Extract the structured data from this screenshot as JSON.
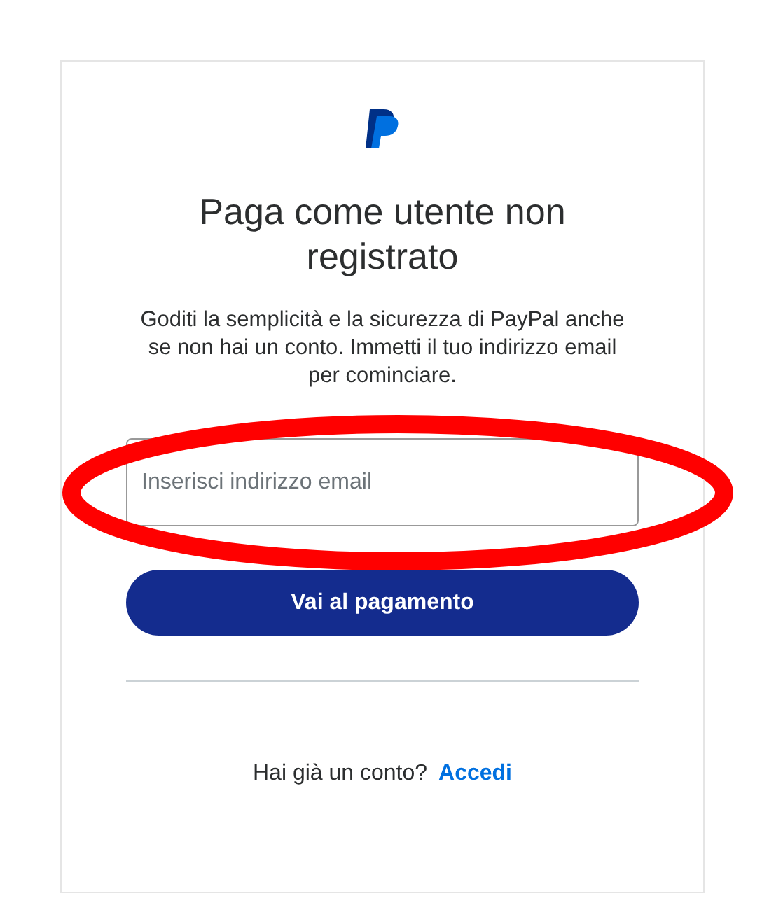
{
  "title": "Paga come utente non registrato",
  "description": "Goditi la semplicità e la sicurezza di PayPal anche se non hai un conto. Immetti il tuo indirizzo email per cominciare.",
  "email_field": {
    "placeholder": "Inserisci indirizzo email"
  },
  "primary_button": "Vai al pagamento",
  "login_prompt": {
    "text": "Hai già un conto?",
    "link": "Accedi"
  }
}
